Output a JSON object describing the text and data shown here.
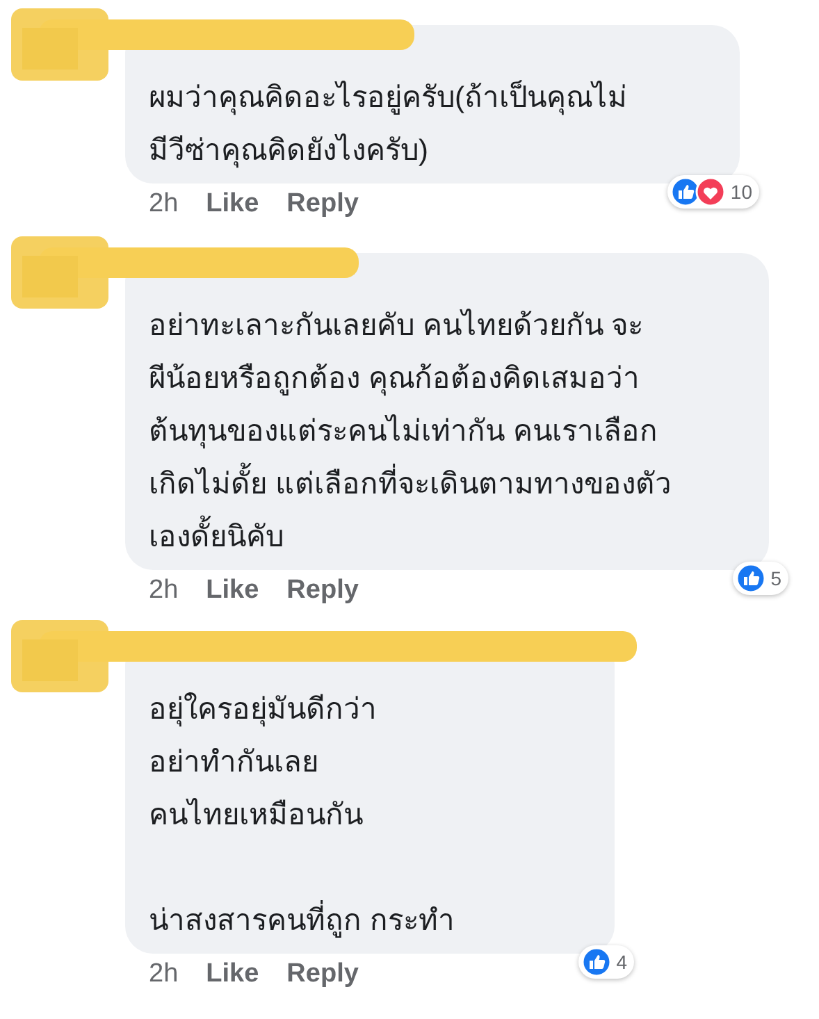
{
  "comments": [
    {
      "text": "ผมว่าคุณคิดอะไรอยู่ครับ(ถ้าเป็นคุณไม่\nมีวีซ่าคุณคิดยังไงครับ)",
      "time": "2h",
      "like": "Like",
      "reply": "Reply",
      "reactions": [
        {
          "kind": "like"
        },
        {
          "kind": "love"
        }
      ],
      "reaction_count": "10"
    },
    {
      "text": "อย่าทะเลาะกันเลยคับ คนไทยด้วยกัน จะ\nผีน้อยหรือถูกต้อง คุณก้อต้องคิดเสมอว่า\nต้นทุนของแต่ระคนไม่เท่ากัน คนเราเลือก\nเกิดไม่ดั้ย แต่เลือกที่จะเดินตามทางของตัว\nเองดั้ยนิคับ",
      "time": "2h",
      "like": "Like",
      "reply": "Reply",
      "reactions": [
        {
          "kind": "like"
        }
      ],
      "reaction_count": "5"
    },
    {
      "text": "อยุ่ใครอยุ่มันดีกว่า\nอย่าทำกันเลย\nคนไทยเหมือนกัน\n\nน่าสงสารคนที่ถูก กระทำ",
      "time": "2h",
      "like": "Like",
      "reply": "Reply",
      "reactions": [
        {
          "kind": "like"
        }
      ],
      "reaction_count": "4"
    }
  ]
}
